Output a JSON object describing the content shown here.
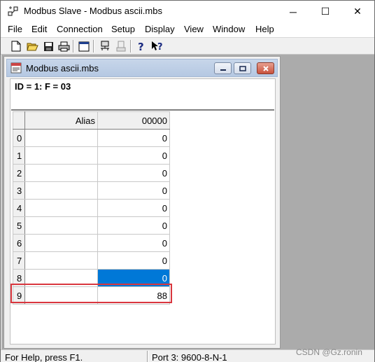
{
  "app": {
    "title": "Modbus Slave - Modbus ascii.mbs",
    "window_controls": {
      "minimize": "─",
      "maximize": "☐",
      "close": "✕"
    }
  },
  "menu": [
    "File",
    "Edit",
    "Connection",
    "Setup",
    "Display",
    "View",
    "Window",
    "Help"
  ],
  "toolbar": {
    "buttons": [
      "new-icon",
      "open-icon",
      "save-icon",
      "print-icon",
      "window-icon",
      "connect-icon",
      "disconnect-icon",
      "help-icon",
      "context-help-icon"
    ]
  },
  "child": {
    "title": "Modbus ascii.mbs",
    "id_line": "ID = 1: F = 03",
    "grid": {
      "headers": {
        "alias": "Alias",
        "value": "00000"
      },
      "rows": [
        {
          "index": "0",
          "alias": "",
          "value": "0"
        },
        {
          "index": "1",
          "alias": "",
          "value": "0"
        },
        {
          "index": "2",
          "alias": "",
          "value": "0"
        },
        {
          "index": "3",
          "alias": "",
          "value": "0"
        },
        {
          "index": "4",
          "alias": "",
          "value": "0"
        },
        {
          "index": "5",
          "alias": "",
          "value": "0"
        },
        {
          "index": "6",
          "alias": "",
          "value": "0"
        },
        {
          "index": "7",
          "alias": "",
          "value": "0"
        },
        {
          "index": "8",
          "alias": "",
          "value": "0"
        },
        {
          "index": "9",
          "alias": "",
          "value": "88"
        }
      ],
      "selected_row": 8,
      "highlighted_row": 9
    }
  },
  "status": {
    "help": "For Help, press F1.",
    "port": "Port 3: 9600-8-N-1"
  },
  "watermark": "CSDN @Gz.ronin",
  "colors": {
    "selection": "#0078d7",
    "highlight_border": "#d9363e",
    "mdi_background": "#ababab"
  }
}
